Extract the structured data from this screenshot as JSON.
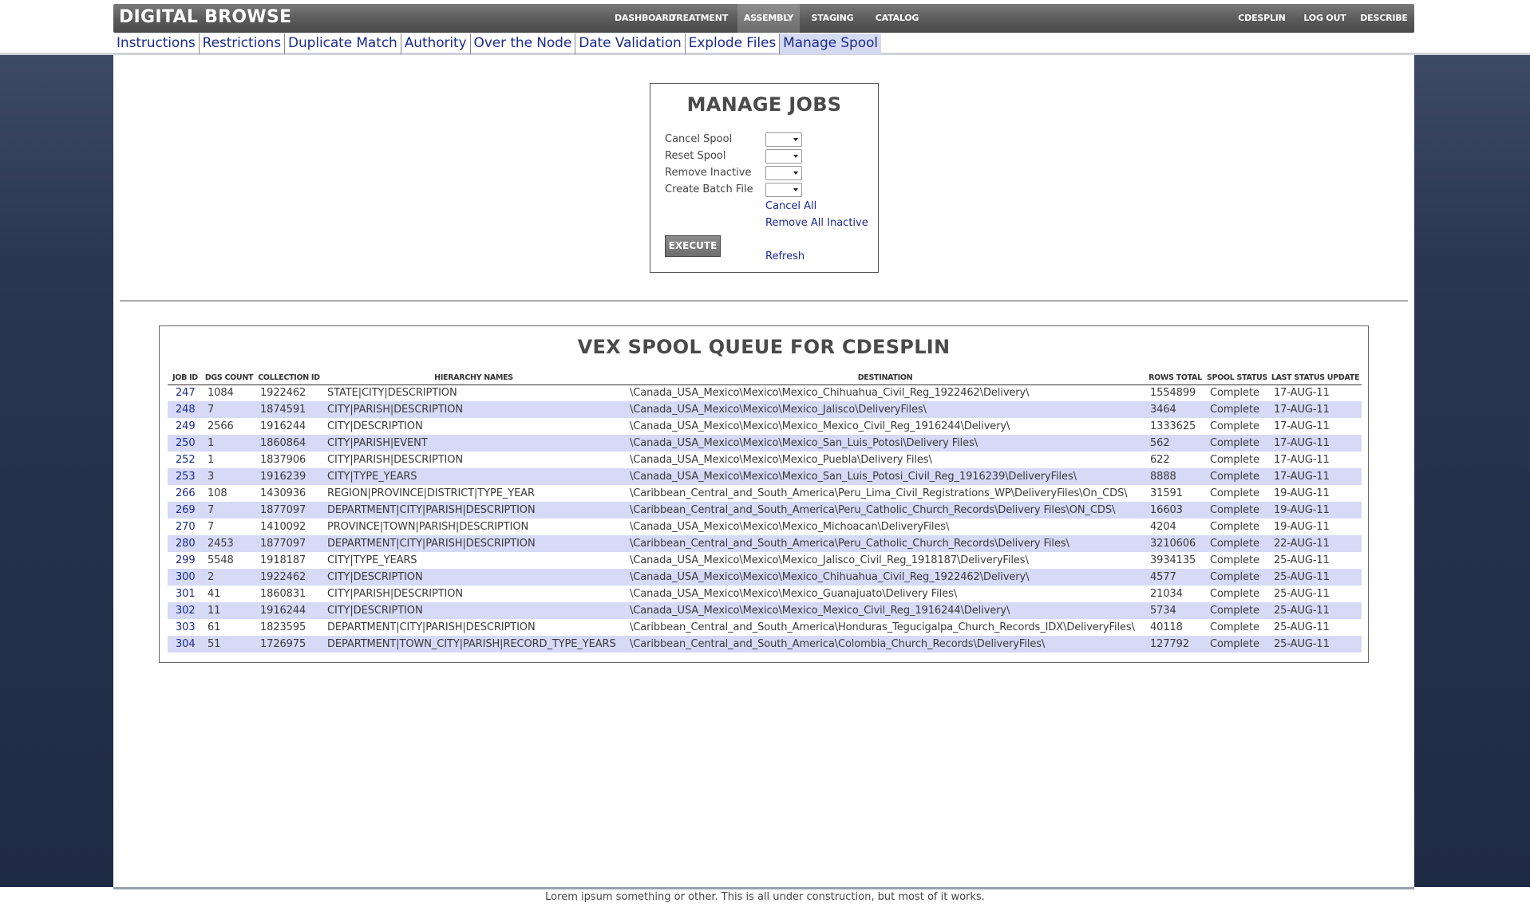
{
  "header": {
    "brand": "DIGITAL BROWSE",
    "nav": [
      "DASHBOARD",
      "TREATMENT",
      "ASSEMBLY",
      "STAGING",
      "CATALOG"
    ],
    "active_nav": "ASSEMBLY",
    "user": "CDESPLIN",
    "logout": "LOG OUT",
    "describe": "DESCRIBE"
  },
  "subnav": {
    "items": [
      "Instructions",
      "Restrictions",
      "Duplicate Match",
      "Authority",
      "Over the Node",
      "Date Validation",
      "Explode Files",
      "Manage Spool"
    ],
    "active": "Manage Spool"
  },
  "manage": {
    "title": "MANAGE JOBS",
    "labels": [
      "Cancel Spool",
      "Reset Spool",
      "Remove Inactive",
      "Create Batch File"
    ],
    "cancel_all": "Cancel All",
    "remove_all_inactive": "Remove All Inactive",
    "execute": "EXECUTE",
    "refresh": "Refresh"
  },
  "queue": {
    "title": "VEX SPOOL QUEUE FOR CDESPLIN",
    "columns": [
      "JOB ID",
      "DGS COUNT",
      "COLLECTION ID",
      "HIERARCHY NAMES",
      "DESTINATION",
      "ROWS TOTAL",
      "SPOOL STATUS",
      "LAST STATUS UPDATE"
    ],
    "rows": [
      [
        "247",
        "1084",
        "1922462",
        "STATE|CITY|DESCRIPTION",
        "\\Canada_USA_Mexico\\Mexico\\Mexico_Chihuahua_Civil_Reg_1922462\\Delivery\\",
        "1554899",
        "Complete",
        "17-AUG-11"
      ],
      [
        "248",
        "7",
        "1874591",
        "CITY|PARISH|DESCRIPTION",
        "\\Canada_USA_Mexico\\Mexico\\Mexico_Jalisco\\DeliveryFiles\\",
        "3464",
        "Complete",
        "17-AUG-11"
      ],
      [
        "249",
        "2566",
        "1916244",
        "CITY|DESCRIPTION",
        "\\Canada_USA_Mexico\\Mexico\\Mexico_Mexico_Civil_Reg_1916244\\Delivery\\",
        "1333625",
        "Complete",
        "17-AUG-11"
      ],
      [
        "250",
        "1",
        "1860864",
        "CITY|PARISH|EVENT",
        "\\Canada_USA_Mexico\\Mexico\\Mexico_San_Luis_Potosi\\Delivery Files\\",
        "562",
        "Complete",
        "17-AUG-11"
      ],
      [
        "252",
        "1",
        "1837906",
        "CITY|PARISH|DESCRIPTION",
        "\\Canada_USA_Mexico\\Mexico\\Mexico_Puebla\\Delivery Files\\",
        "622",
        "Complete",
        "17-AUG-11"
      ],
      [
        "253",
        "3",
        "1916239",
        "CITY|TYPE_YEARS",
        "\\Canada_USA_Mexico\\Mexico\\Mexico_San_Luis_Potosi_Civil_Reg_1916239\\DeliveryFiles\\",
        "8888",
        "Complete",
        "17-AUG-11"
      ],
      [
        "266",
        "108",
        "1430936",
        "REGION|PROVINCE|DISTRICT|TYPE_YEAR",
        "\\Caribbean_Central_and_South_America\\Peru_Lima_Civil_Registrations_WP\\DeliveryFiles\\On_CDS\\",
        "31591",
        "Complete",
        "19-AUG-11"
      ],
      [
        "269",
        "7",
        "1877097",
        "DEPARTMENT|CITY|PARISH|DESCRIPTION",
        "\\Caribbean_Central_and_South_America\\Peru_Catholic_Church_Records\\Delivery Files\\ON_CDS\\",
        "16603",
        "Complete",
        "19-AUG-11"
      ],
      [
        "270",
        "7",
        "1410092",
        "PROVINCE|TOWN|PARISH|DESCRIPTION",
        "\\Canada_USA_Mexico\\Mexico\\Mexico_Michoacan\\DeliveryFiles\\",
        "4204",
        "Complete",
        "19-AUG-11"
      ],
      [
        "280",
        "2453",
        "1877097",
        "DEPARTMENT|CITY|PARISH|DESCRIPTION",
        "\\Caribbean_Central_and_South_America\\Peru_Catholic_Church_Records\\Delivery Files\\",
        "3210606",
        "Complete",
        "22-AUG-11"
      ],
      [
        "299",
        "5548",
        "1918187",
        "CITY|TYPE_YEARS",
        "\\Canada_USA_Mexico\\Mexico\\Mexico_Jalisco_Civil_Reg_1918187\\DeliveryFiles\\",
        "3934135",
        "Complete",
        "25-AUG-11"
      ],
      [
        "300",
        "2",
        "1922462",
        "CITY|DESCRIPTION",
        "\\Canada_USA_Mexico\\Mexico\\Mexico_Chihuahua_Civil_Reg_1922462\\Delivery\\",
        "4577",
        "Complete",
        "25-AUG-11"
      ],
      [
        "301",
        "41",
        "1860831",
        "CITY|PARISH|DESCRIPTION",
        "\\Canada_USA_Mexico\\Mexico\\Mexico_Guanajuato\\Delivery Files\\",
        "21034",
        "Complete",
        "25-AUG-11"
      ],
      [
        "302",
        "11",
        "1916244",
        "CITY|DESCRIPTION",
        "\\Canada_USA_Mexico\\Mexico\\Mexico_Mexico_Civil_Reg_1916244\\Delivery\\",
        "5734",
        "Complete",
        "25-AUG-11"
      ],
      [
        "303",
        "61",
        "1823595",
        "DEPARTMENT|CITY|PARISH|DESCRIPTION",
        "\\Caribbean_Central_and_South_America\\Honduras_Tegucigalpa_Church_Records_IDX\\DeliveryFiles\\",
        "40118",
        "Complete",
        "25-AUG-11"
      ],
      [
        "304",
        "51",
        "1726975",
        "DEPARTMENT|TOWN_CITY|PARISH|RECORD_TYPE_YEARS",
        "\\Caribbean_Central_and_South_America\\Colombia_Church_Records\\DeliveryFiles\\",
        "127792",
        "Complete",
        "25-AUG-11"
      ]
    ]
  },
  "footer": "Lorem ipsum something or other. This is all under construction, but most of it works."
}
